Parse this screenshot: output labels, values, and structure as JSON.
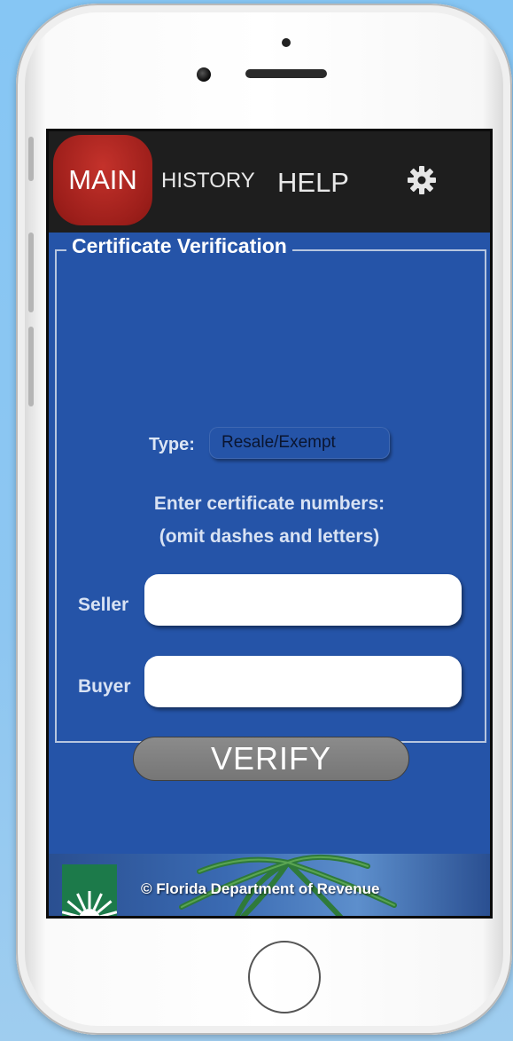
{
  "nav": {
    "main_label": "MAIN",
    "history_label": "HISTORY",
    "help_label": "HELP"
  },
  "section": {
    "title": "Certificate Verification"
  },
  "form": {
    "type_label": "Type:",
    "type_value": "Resale/Exempt",
    "instruction_line1": "Enter certificate numbers:",
    "instruction_line2": "(omit dashes and letters)",
    "seller_label": "Seller",
    "seller_value": "",
    "buyer_label": "Buyer",
    "buyer_value": "",
    "verify_label": "VERIFY"
  },
  "footer": {
    "copyright": "© Florida Department of Revenue"
  },
  "icons": {
    "settings": "gear-icon",
    "logo": "sun-logo-icon"
  },
  "colors": {
    "accent_red": "#9e1f1b",
    "content_blue": "#2554a8",
    "topbar": "#1e1e1e",
    "button_gray": "#7d7d7d"
  }
}
